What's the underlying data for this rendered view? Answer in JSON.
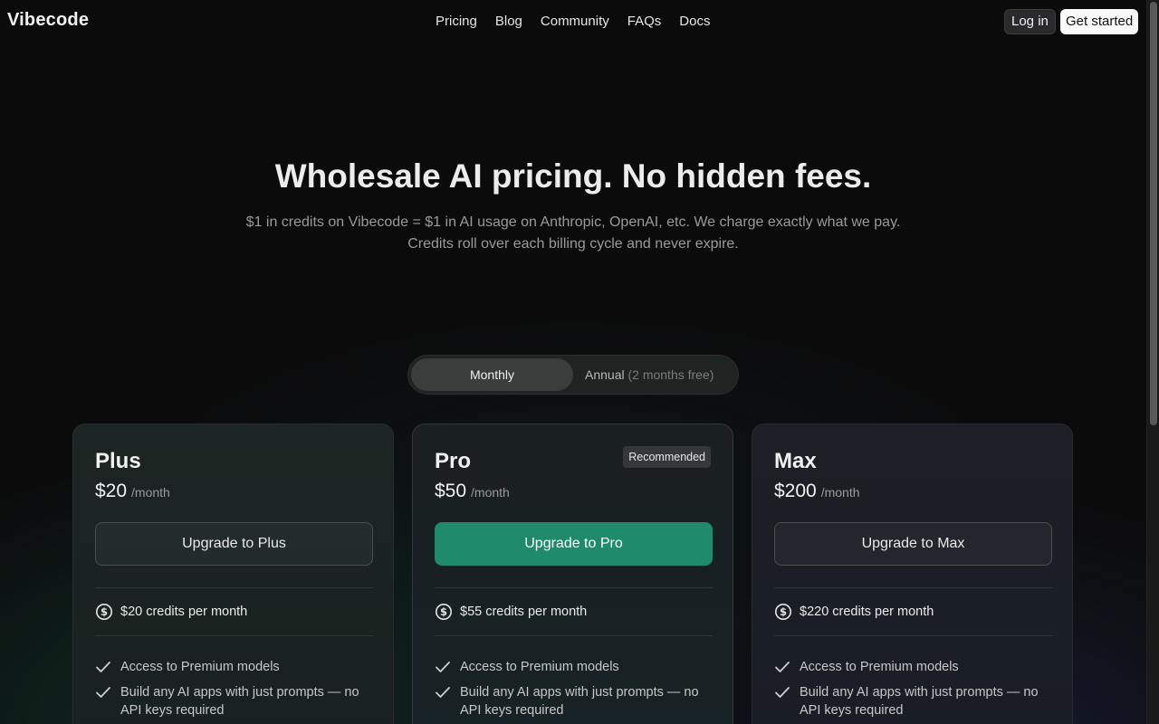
{
  "header": {
    "logo": "Vibecode",
    "nav": [
      "Pricing",
      "Blog",
      "Community",
      "FAQs",
      "Docs"
    ],
    "login_label": "Log in",
    "get_started_label": "Get started"
  },
  "hero": {
    "title": "Wholesale AI pricing. No hidden fees.",
    "subtitle_line1": "$1 in credits on Vibecode = $1 in AI usage on Anthropic, OpenAI, etc. We charge exactly what we pay.",
    "subtitle_line2": "Credits roll over each billing cycle and never expire."
  },
  "billing_toggle": {
    "monthly_label": "Monthly",
    "annual_label": "Annual",
    "annual_note": "(2 months free)",
    "selected": "Monthly"
  },
  "plans": [
    {
      "name": "Plus",
      "price": "$20",
      "period": "/month",
      "button_label": "Upgrade to Plus",
      "credits": "$20 credits per month",
      "features": [
        "Access to Premium models",
        "Build any AI apps with just prompts — no API keys required"
      ]
    },
    {
      "name": "Pro",
      "badge": "Recommended",
      "price": "$50",
      "period": "/month",
      "button_label": "Upgrade to Pro",
      "credits": "$55 credits per month",
      "features": [
        "Access to Premium models",
        "Build any AI apps with just prompts — no API keys required"
      ]
    },
    {
      "name": "Max",
      "price": "$200",
      "period": "/month",
      "button_label": "Upgrade to Max",
      "credits": "$220 credits per month",
      "features": [
        "Access to Premium models",
        "Build any AI apps with just prompts — no API keys required"
      ]
    }
  ],
  "colors": {
    "accent": "#1f8a6c",
    "background": "#0b0b0c"
  }
}
